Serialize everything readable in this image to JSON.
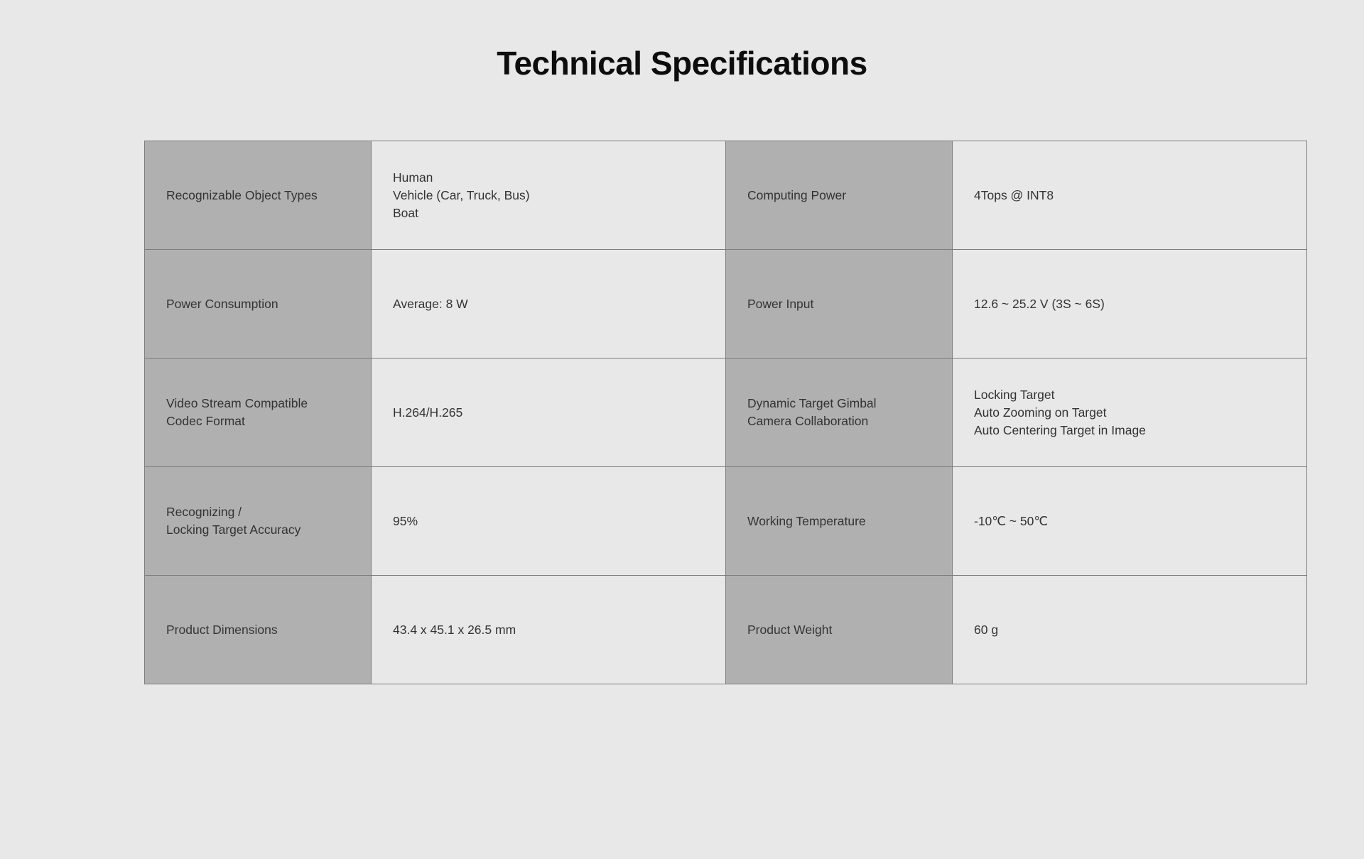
{
  "page": {
    "title": "Technical Specifications",
    "background_color": "#e8e8e8",
    "label_cell_color": "#b0b0b0",
    "value_cell_color": "#e8e8e8",
    "border_color": "#1a1a1a"
  },
  "table": {
    "rows": [
      {
        "label_left": "Recognizable Object Types",
        "value_left": "Human\nVehicle (Car, Truck, Bus)\nBoat",
        "label_right": "Computing Power",
        "value_right": "4Tops @ INT8"
      },
      {
        "label_left": "Power Consumption",
        "value_left": "Average: 8 W",
        "label_right": "Power Input",
        "value_right": "12.6 ~ 25.2 V   (3S ~ 6S)"
      },
      {
        "label_left": "Video Stream Compatible\nCodec Format",
        "value_left": "H.264/H.265",
        "label_right": "Dynamic Target Gimbal\nCamera Collaboration",
        "value_right": "Locking Target\nAuto Zooming on Target\nAuto Centering Target in Image"
      },
      {
        "label_left": "Recognizing /\nLocking Target Accuracy",
        "value_left": "95%",
        "label_right": "Working Temperature",
        "value_right": "-10℃ ~ 50℃"
      },
      {
        "label_left": "Product Dimensions",
        "value_left": "43.4 x 45.1 x 26.5 mm",
        "label_right": "Product Weight",
        "value_right": "60 g"
      }
    ]
  }
}
